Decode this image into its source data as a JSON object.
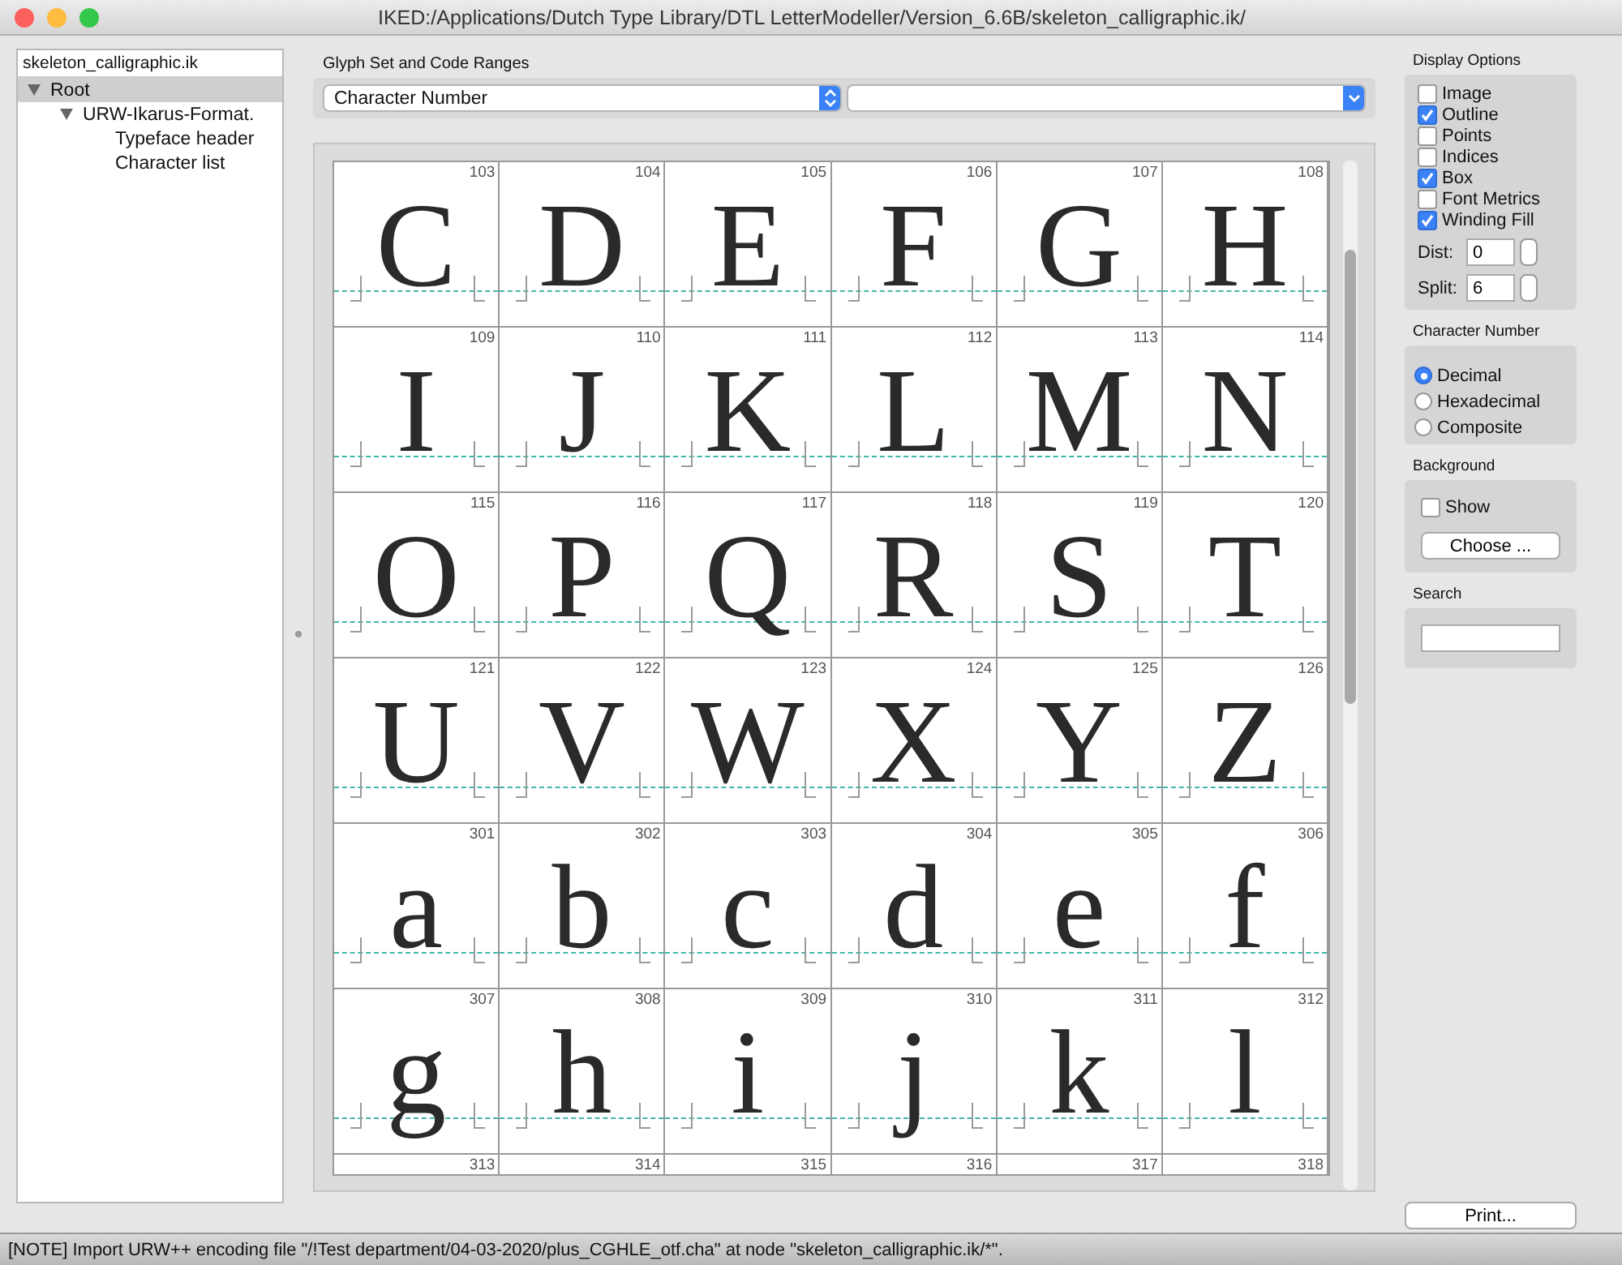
{
  "window": {
    "title": "IKED:/Applications/Dutch Type Library/DTL LetterModeller/Version_6.6B/skeleton_calligraphic.ik/"
  },
  "tree": {
    "header": "skeleton_calligraphic.ik",
    "items": [
      {
        "label": "Root",
        "expanded": true,
        "selected": true,
        "children": [
          {
            "label": "URW-Ikarus-Format.",
            "expanded": true,
            "selected": false,
            "children": [
              {
                "label": "Typeface header",
                "selected": false
              },
              {
                "label": "Character list",
                "selected": false
              }
            ]
          }
        ]
      }
    ]
  },
  "glyph_set": {
    "label": "Glyph Set and Code Ranges",
    "selector": "Character Number"
  },
  "glyphs": [
    {
      "number": "103",
      "glyph": "C"
    },
    {
      "number": "104",
      "glyph": "D"
    },
    {
      "number": "105",
      "glyph": "E"
    },
    {
      "number": "106",
      "glyph": "F"
    },
    {
      "number": "107",
      "glyph": "G"
    },
    {
      "number": "108",
      "glyph": "H"
    },
    {
      "number": "109",
      "glyph": "I"
    },
    {
      "number": "110",
      "glyph": "J"
    },
    {
      "number": "111",
      "glyph": "K"
    },
    {
      "number": "112",
      "glyph": "L"
    },
    {
      "number": "113",
      "glyph": "M"
    },
    {
      "number": "114",
      "glyph": "N"
    },
    {
      "number": "115",
      "glyph": "O"
    },
    {
      "number": "116",
      "glyph": "P"
    },
    {
      "number": "117",
      "glyph": "Q"
    },
    {
      "number": "118",
      "glyph": "R"
    },
    {
      "number": "119",
      "glyph": "S"
    },
    {
      "number": "120",
      "glyph": "T"
    },
    {
      "number": "121",
      "glyph": "U"
    },
    {
      "number": "122",
      "glyph": "V"
    },
    {
      "number": "123",
      "glyph": "W"
    },
    {
      "number": "124",
      "glyph": "X"
    },
    {
      "number": "125",
      "glyph": "Y"
    },
    {
      "number": "126",
      "glyph": "Z"
    },
    {
      "number": "301",
      "glyph": "a"
    },
    {
      "number": "302",
      "glyph": "b"
    },
    {
      "number": "303",
      "glyph": "c"
    },
    {
      "number": "304",
      "glyph": "d"
    },
    {
      "number": "305",
      "glyph": "e"
    },
    {
      "number": "306",
      "glyph": "f"
    },
    {
      "number": "307",
      "glyph": "g"
    },
    {
      "number": "308",
      "glyph": "h"
    },
    {
      "number": "309",
      "glyph": "i"
    },
    {
      "number": "310",
      "glyph": "j"
    },
    {
      "number": "311",
      "glyph": "k"
    },
    {
      "number": "312",
      "glyph": "l"
    },
    {
      "number": "313"
    },
    {
      "number": "314"
    },
    {
      "number": "315"
    },
    {
      "number": "316"
    },
    {
      "number": "317"
    },
    {
      "number": "318"
    }
  ],
  "display_options": {
    "title": "Display Options",
    "checkboxes": [
      {
        "label": "Image",
        "checked": false
      },
      {
        "label": "Outline",
        "checked": true
      },
      {
        "label": "Points",
        "checked": false
      },
      {
        "label": "Indices",
        "checked": false
      },
      {
        "label": "Box",
        "checked": true
      },
      {
        "label": "Font Metrics",
        "checked": false
      },
      {
        "label": "Winding Fill",
        "checked": true
      }
    ],
    "fields": [
      {
        "label": "Dist:",
        "value": "0"
      },
      {
        "label": "Split:",
        "value": "6"
      }
    ]
  },
  "character_number": {
    "title": "Character Number",
    "options": [
      {
        "label": "Decimal",
        "selected": true
      },
      {
        "label": "Hexadecimal",
        "selected": false
      },
      {
        "label": "Composite",
        "selected": false
      }
    ]
  },
  "background": {
    "title": "Background",
    "show": {
      "label": "Show",
      "checked": false
    },
    "button": "Choose ..."
  },
  "search": {
    "title": "Search"
  },
  "print_button": "Print...",
  "status_bar": "[NOTE] Import URW++ encoding file \"/!Test department/04-03-2020/plus_CGHLE_otf.cha\" at node \"skeleton_calligraphic.ik/*\"."
}
